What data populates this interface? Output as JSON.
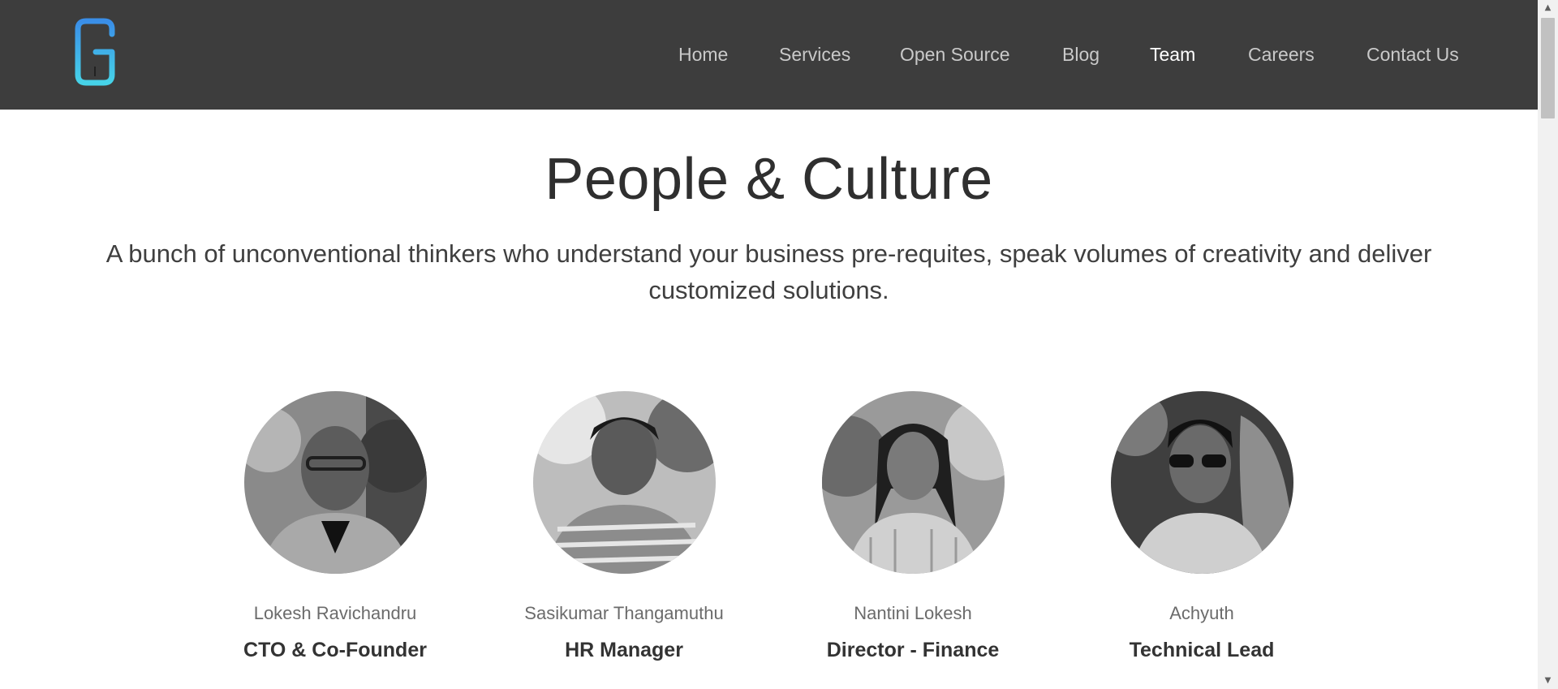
{
  "header": {
    "nav": [
      {
        "label": "Home",
        "active": false
      },
      {
        "label": "Services",
        "active": false
      },
      {
        "label": "Open Source",
        "active": false
      },
      {
        "label": "Blog",
        "active": false
      },
      {
        "label": "Team",
        "active": true
      },
      {
        "label": "Careers",
        "active": false
      },
      {
        "label": "Contact Us",
        "active": false
      }
    ]
  },
  "main": {
    "title": "People & Culture",
    "subtitle": "A bunch of unconventional thinkers who understand your business pre-requites, speak volumes of creativity and deliver customized solutions.",
    "team": [
      {
        "name": "Lokesh Ravichandru",
        "role": "CTO & Co-Founder"
      },
      {
        "name": "Sasikumar Thangamuthu",
        "role": "HR Manager"
      },
      {
        "name": "Nantini Lokesh",
        "role": "Director - Finance"
      },
      {
        "name": "Achyuth",
        "role": "Technical Lead"
      }
    ]
  },
  "colors": {
    "header_bg": "#3d3d3d",
    "logo_gradient_top": "#3a8ee8",
    "logo_gradient_bottom": "#46d3e8",
    "nav_text": "#c9c9c9",
    "nav_active": "#ffffff"
  },
  "icons": {
    "logo": "company-logo",
    "scroll_up": "scroll-up-icon",
    "scroll_down": "scroll-down-icon"
  }
}
